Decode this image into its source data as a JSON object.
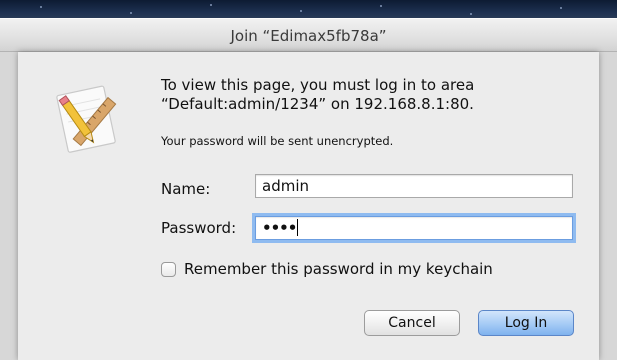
{
  "window": {
    "title": "Join “Edimax5fb78a”"
  },
  "dialog": {
    "icon": "script-editor-pencil-ruler-icon",
    "message_line1": "To view this page, you must log in to area",
    "message_line2": "“Default:admin/1234” on 192.168.8.1:80.",
    "note": "Your password will be sent unencrypted."
  },
  "form": {
    "name_label": "Name:",
    "name_value": "admin",
    "password_label": "Password:",
    "password_value": "••••",
    "remember_label": "Remember this password in my keychain",
    "remember_checked": false
  },
  "buttons": {
    "cancel_label": "Cancel",
    "login_label": "Log In"
  },
  "colors": {
    "focus_ring": "#8fbbf0",
    "default_button": "#a9cdf6",
    "sheet_background": "#ececec"
  }
}
